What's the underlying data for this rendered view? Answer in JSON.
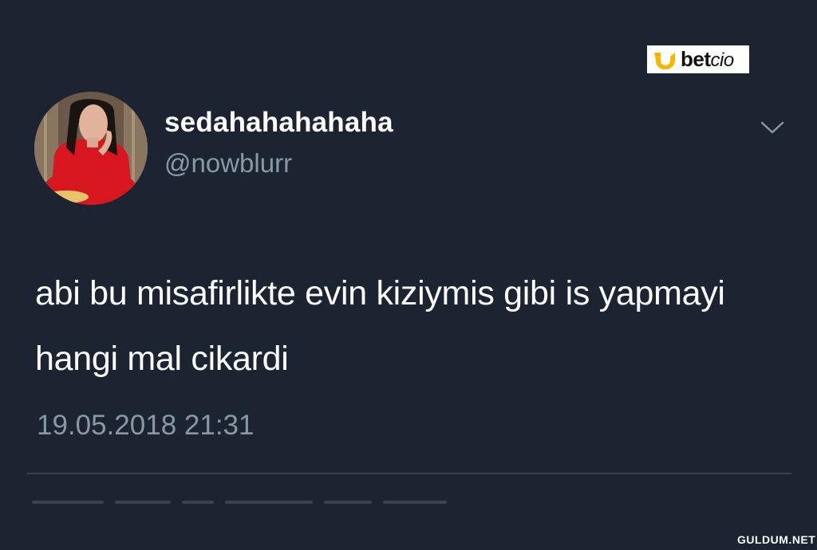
{
  "watermark": {
    "brand": "betcio",
    "brand_bold": "bet",
    "brand_light": "cio",
    "brand_color": "#f5b800",
    "site_mark": "GULDUM.NET"
  },
  "tweet": {
    "display_name": "sedahahahahaha",
    "handle": "@nowblurr",
    "text": "abi bu misafirlikte evin kiziymis gibi is yapmayi hangi mal cikardi",
    "timestamp": "19.05.2018 21:31",
    "menu_icon": "chevron-down-icon",
    "avatar_icon": "avatar"
  },
  "colors": {
    "background": "#1c2431",
    "primary_text": "#ffffff",
    "secondary_text": "#8899a6",
    "divider": "#38444d",
    "avatar_shirt": "#d8161f"
  }
}
